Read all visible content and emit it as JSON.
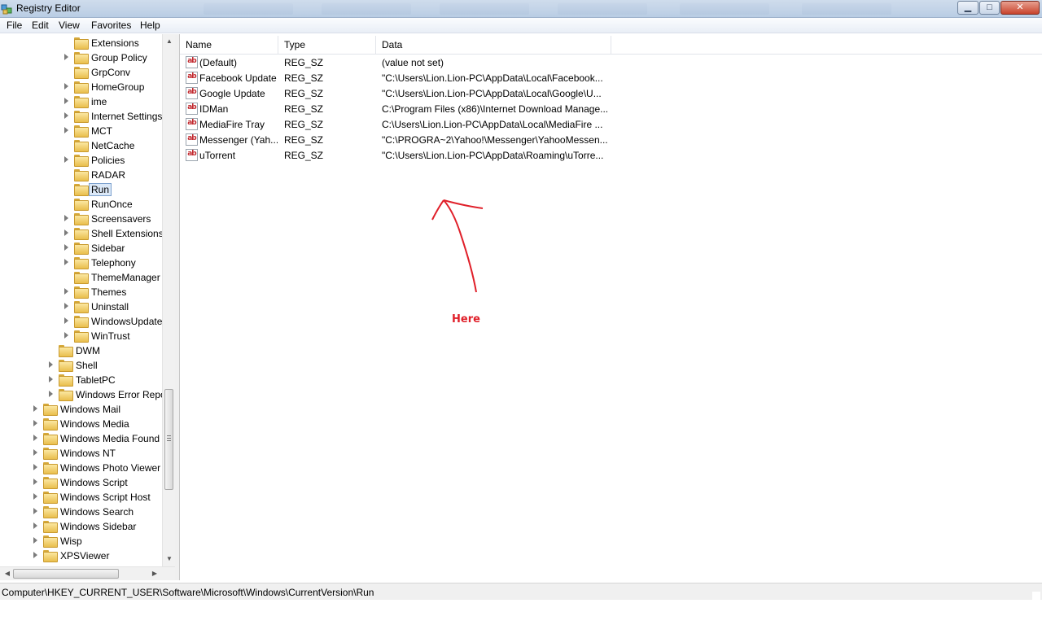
{
  "window": {
    "title": "Registry Editor",
    "minimize_glyph": "▁",
    "maximize_glyph": "□",
    "close_glyph": "✕"
  },
  "menu": {
    "items": [
      "File",
      "Edit",
      "View",
      "Favorites",
      "Help"
    ]
  },
  "tree": {
    "nodes": [
      {
        "label": "Extensions"
      },
      {
        "label": "Group Policy"
      },
      {
        "label": "GrpConv"
      },
      {
        "label": "HomeGroup"
      },
      {
        "label": "ime"
      },
      {
        "label": "Internet Settings"
      },
      {
        "label": "MCT"
      },
      {
        "label": "NetCache"
      },
      {
        "label": "Policies"
      },
      {
        "label": "RADAR"
      },
      {
        "label": "Run"
      },
      {
        "label": "RunOnce"
      },
      {
        "label": "Screensavers"
      },
      {
        "label": "Shell Extensions"
      },
      {
        "label": "Sidebar"
      },
      {
        "label": "Telephony"
      },
      {
        "label": "ThemeManager"
      },
      {
        "label": "Themes"
      },
      {
        "label": "Uninstall"
      },
      {
        "label": "WindowsUpdate"
      },
      {
        "label": "WinTrust"
      },
      {
        "label": "DWM"
      },
      {
        "label": "Shell"
      },
      {
        "label": "TabletPC"
      },
      {
        "label": "Windows Error Repo"
      },
      {
        "label": "Windows Mail"
      },
      {
        "label": "Windows Media"
      },
      {
        "label": "Windows Media Found"
      },
      {
        "label": "Windows NT"
      },
      {
        "label": "Windows Photo Viewer"
      },
      {
        "label": "Windows Script"
      },
      {
        "label": "Windows Script Host"
      },
      {
        "label": "Windows Search"
      },
      {
        "label": "Windows Sidebar"
      },
      {
        "label": "Wisp"
      },
      {
        "label": "XPSViewer"
      }
    ],
    "selected": "Run"
  },
  "list": {
    "columns": [
      "Name",
      "Type",
      "Data"
    ],
    "rows": [
      {
        "name": "(Default)",
        "type": "REG_SZ",
        "data": "(value not set)"
      },
      {
        "name": "Facebook Update",
        "type": "REG_SZ",
        "data": "\"C:\\Users\\Lion.Lion-PC\\AppData\\Local\\Facebook..."
      },
      {
        "name": "Google Update",
        "type": "REG_SZ",
        "data": "\"C:\\Users\\Lion.Lion-PC\\AppData\\Local\\Google\\U..."
      },
      {
        "name": "IDMan",
        "type": "REG_SZ",
        "data": "C:\\Program Files (x86)\\Internet Download Manage..."
      },
      {
        "name": "MediaFire Tray",
        "type": "REG_SZ",
        "data": "C:\\Users\\Lion.Lion-PC\\AppData\\Local\\MediaFire ..."
      },
      {
        "name": "Messenger (Yah...",
        "type": "REG_SZ",
        "data": "\"C:\\PROGRA~2\\Yahoo!\\Messenger\\YahooMessen..."
      },
      {
        "name": "uTorrent",
        "type": "REG_SZ",
        "data": "\"C:\\Users\\Lion.Lion-PC\\AppData\\Roaming\\uTorre..."
      }
    ],
    "value_icon_text": "ab"
  },
  "annotation": {
    "label": "Here",
    "color": "#e0202a"
  },
  "status": {
    "path": "Computer\\HKEY_CURRENT_USER\\Software\\Microsoft\\Windows\\CurrentVersion\\Run"
  },
  "colors": {
    "titlebar": "#c4d5ea",
    "selection": "#dce9f8",
    "folder": "#e9be4c"
  }
}
